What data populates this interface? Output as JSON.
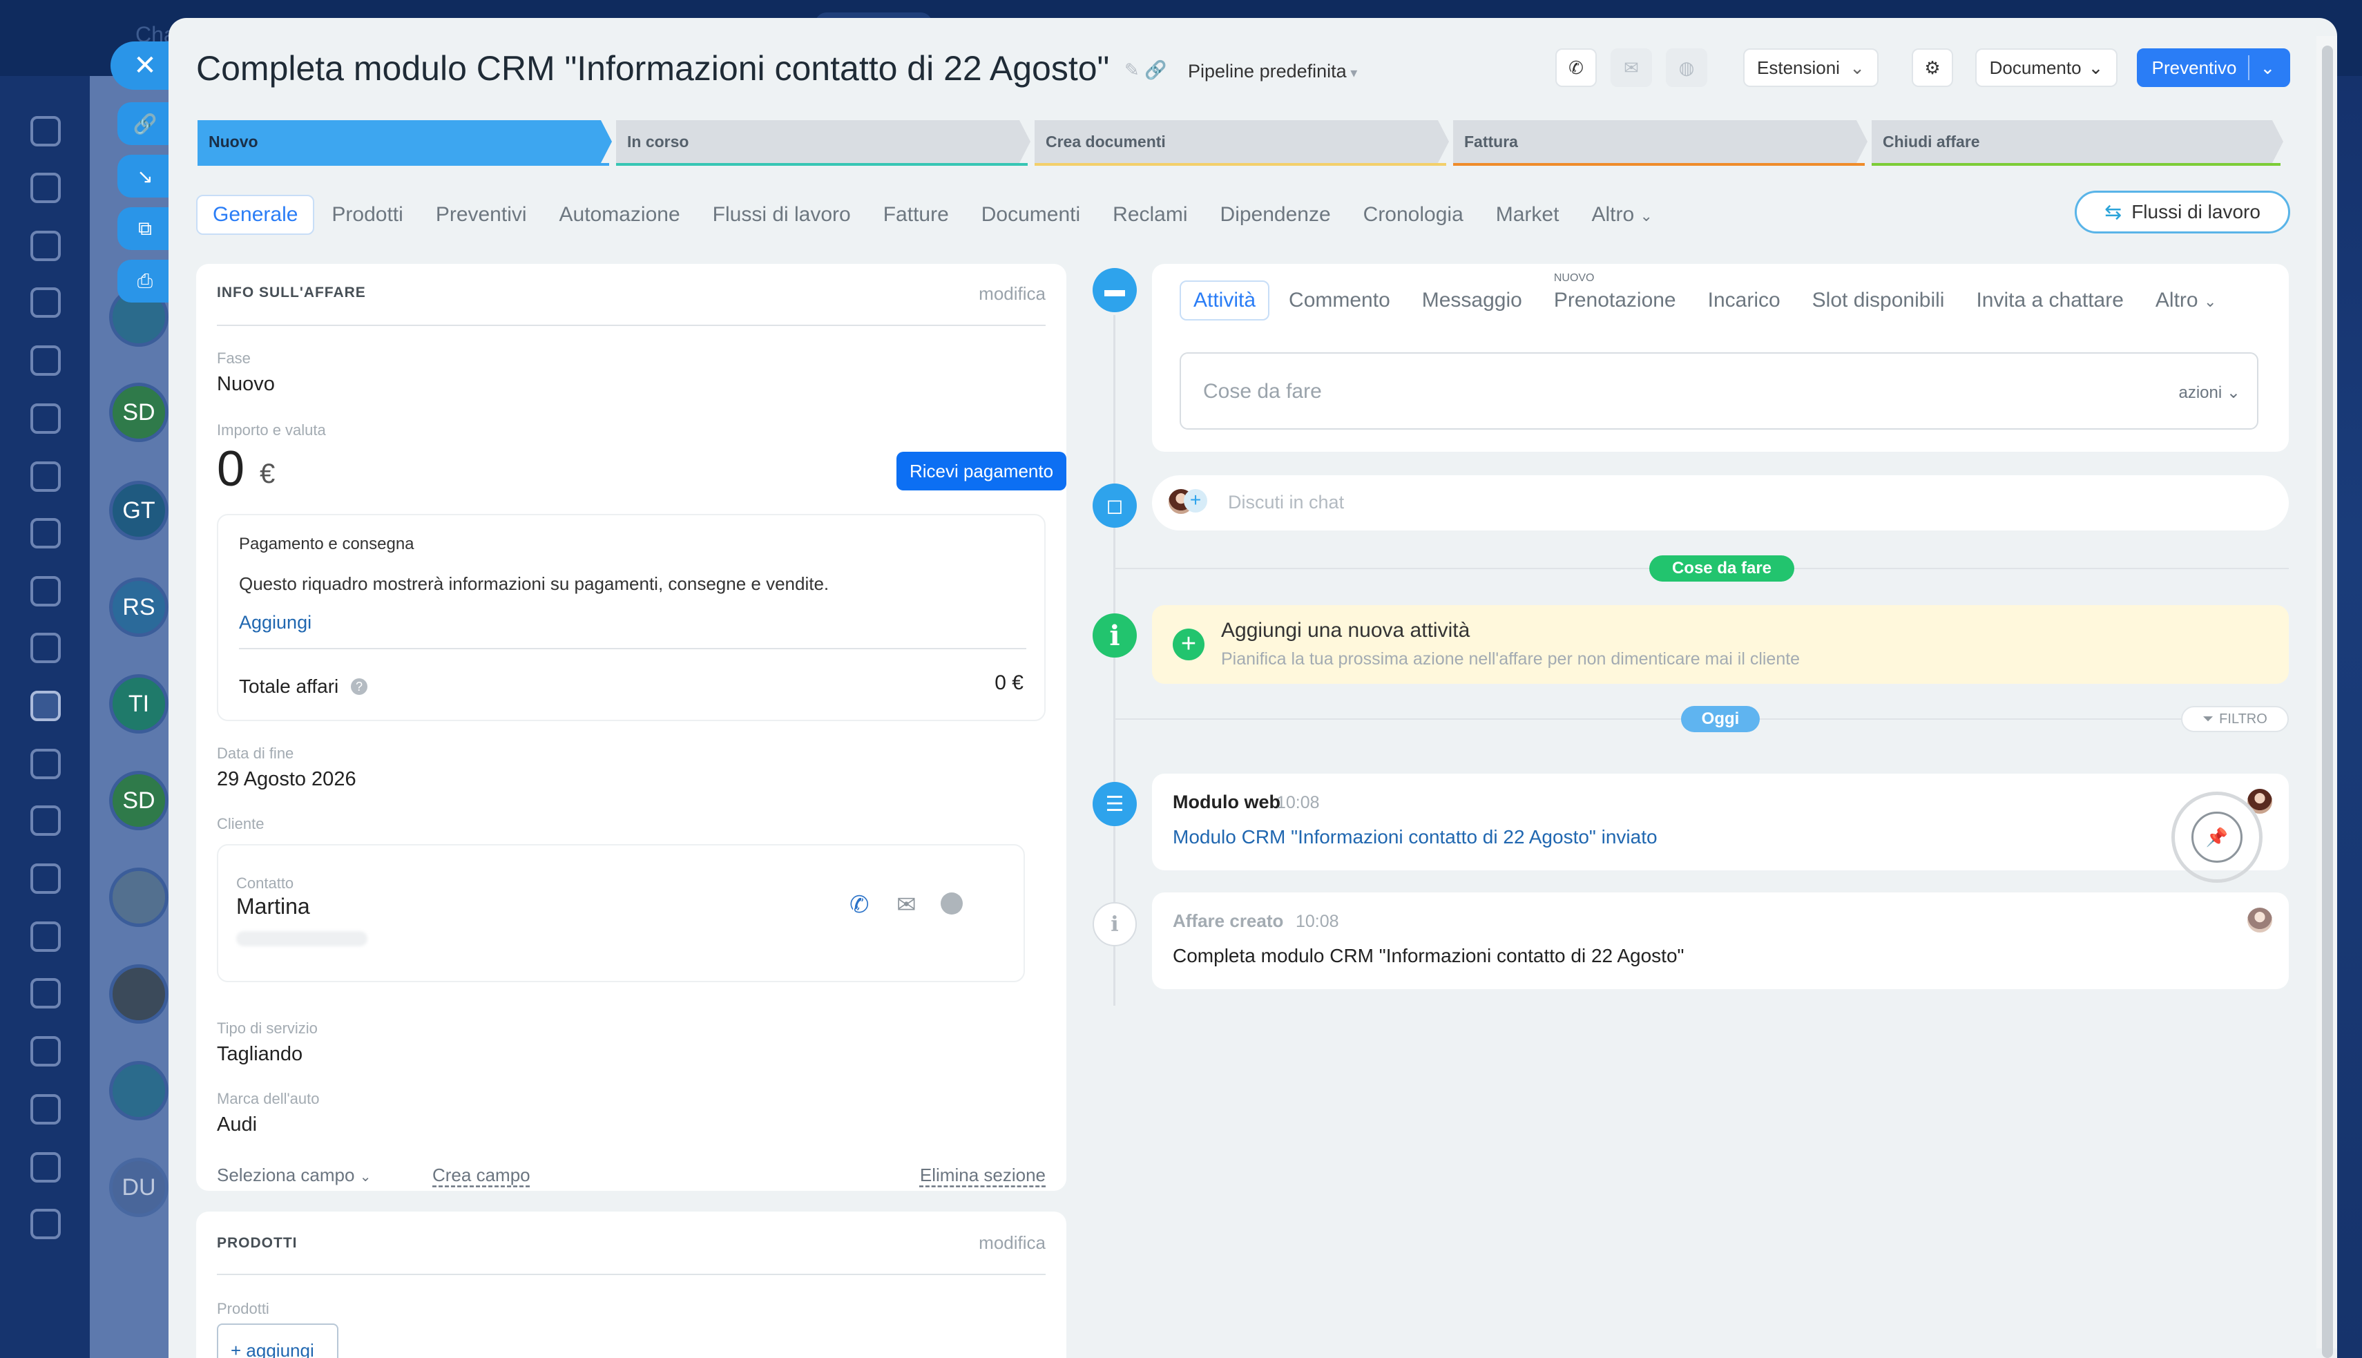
{
  "background": {
    "topbar_text": "Cha",
    "rail_avatars": [
      "SD",
      "GT",
      "RS",
      "TI",
      "SD",
      "DU"
    ]
  },
  "header": {
    "title": "Completa modulo CRM \"Informazioni contatto di 22 Agosto\"",
    "pipeline": "Pipeline predefinita",
    "extensions_label": "Estensioni",
    "document_label": "Documento",
    "quote_label": "Preventivo"
  },
  "stages": [
    {
      "label": "Nuovo",
      "color": "#3da6f0"
    },
    {
      "label": "In corso",
      "color": "#37c6b4"
    },
    {
      "label": "Crea documenti",
      "color": "#f3cf6a"
    },
    {
      "label": "Fattura",
      "color": "#ef8c2a"
    },
    {
      "label": "Chiudi affare",
      "color": "#7ccc36"
    }
  ],
  "tabs": [
    "Generale",
    "Prodotti",
    "Preventivi",
    "Automazione",
    "Flussi di lavoro",
    "Fatture",
    "Documenti",
    "Reclami",
    "Dipendenze",
    "Cronologia",
    "Market",
    "Altro"
  ],
  "workflows_button": "Flussi di lavoro",
  "deal_info": {
    "section_title": "INFO SULL'AFFARE",
    "edit": "modifica",
    "stage_label": "Fase",
    "stage_value": "Nuovo",
    "amount_label": "Importo e valuta",
    "amount_value": "0",
    "currency": "€",
    "receive_payment": "Ricevi pagamento",
    "payment_box": {
      "title": "Pagamento e consegna",
      "description": "Questo riquadro mostrerà informazioni su pagamenti, consegne e vendite.",
      "add_link": "Aggiungi",
      "total_label": "Totale affari",
      "total_value": "0 €"
    },
    "end_date_label": "Data di fine",
    "end_date_value": "29 Agosto 2026",
    "client_label": "Cliente",
    "contact_label": "Contatto",
    "contact_name": "Martina",
    "service_label": "Tipo di servizio",
    "service_value": "Tagliando",
    "car_label": "Marca dell'auto",
    "car_value": "Audi",
    "select_field": "Seleziona campo",
    "create_field": "Crea campo",
    "delete_section": "Elimina sezione"
  },
  "products": {
    "section_title": "PRODOTTI",
    "edit": "modifica",
    "products_label": "Prodotti",
    "add_button": "+ aggiungi"
  },
  "activity": {
    "tabs": [
      "Attività",
      "Commento",
      "Messaggio",
      "Prenotazione",
      "Incarico",
      "Slot disponibili",
      "Invita a chattare",
      "Altro"
    ],
    "new_badge": "NUOVO",
    "todo_placeholder": "Cose da fare",
    "actions": "azioni",
    "chat_placeholder": "Discuti in chat",
    "todo_chip": "Cose da fare",
    "suggest_title": "Aggiungi una nuova attività",
    "suggest_subtitle": "Pianifica la tua prossima azione nell'affare per non dimenticare mai il cliente",
    "today_chip": "Oggi",
    "filter": "FILTRO",
    "webform": {
      "title": "Modulo web",
      "time": "10:08",
      "link": "Modulo CRM \"Informazioni contatto di 22 Agosto\" inviato"
    },
    "created": {
      "title": "Affare creato",
      "time": "10:08",
      "text": "Completa modulo CRM \"Informazioni contatto di 22 Agosto\""
    }
  }
}
